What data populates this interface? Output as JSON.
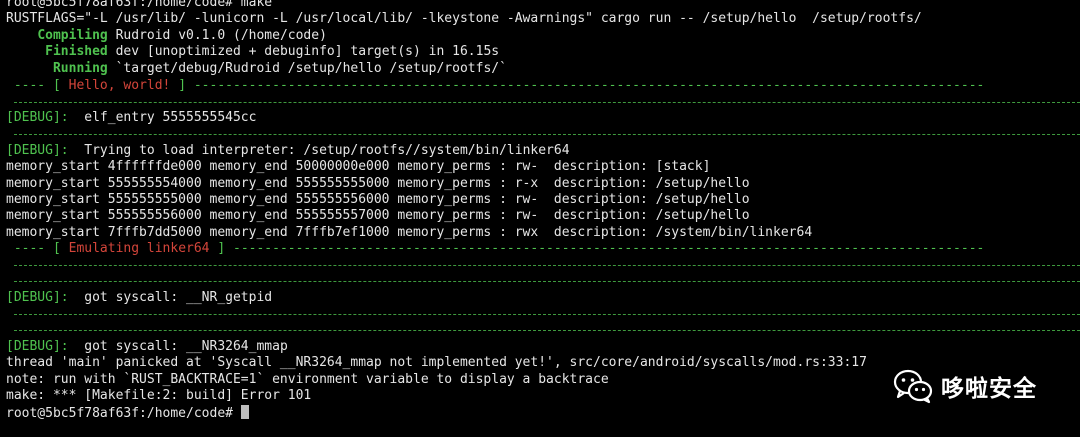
{
  "terminal": {
    "prompt_top": "root@5bc5f78af63f:/home/code# make",
    "cmd_rustflags": "RUSTFLAGS=\"-L /usr/lib/ -lunicorn -L /usr/local/lib/ -lkeystone -Awarnings\" cargo run -- /setup/hello  /setup/rootfs/",
    "compiling_label": "Compiling",
    "compiling_text": " Rudroid v0.1.0 (/home/code)",
    "finished_label": "Finished",
    "finished_text": " dev [unoptimized + debuginfo] target(s) in 16.15s",
    "running_label": "Running",
    "running_text": " `target/debug/Rudroid /setup/hello /setup/rootfs/`",
    "banner1_prefix": " ---- [ ",
    "banner1_text": "Hello, world!",
    "banner1_suffix": " ] -----------------------------------------------------------------------------------------------------",
    "debug_tag": "[DEBUG]:",
    "debug1_text": "  elf_entry 5555555545cc",
    "debug2_text": "  Trying to load interpreter: /setup/rootfs//system/bin/linker64",
    "mem_rows": [
      "memory_start 4ffffffde000 memory_end 50000000e000 memory_perms : rw-  description: [stack]",
      "memory_start 555555554000 memory_end 555555555000 memory_perms : r-x  description: /setup/hello",
      "memory_start 555555555000 memory_end 555555556000 memory_perms : rw-  description: /setup/hello",
      "memory_start 555555556000 memory_end 555555557000 memory_perms : rw-  description: /setup/hello",
      "memory_start 7fffb7dd5000 memory_end 7fffb7ef1000 memory_perms : rwx  description: /system/bin/linker64"
    ],
    "banner2_prefix": " ---- [ ",
    "banner2_text": "Emulating linker64",
    "banner2_suffix": " ] ------------------------------------------------------------------------------------------------",
    "debug3_text": "  got syscall: __NR_getpid",
    "debug4_text": "  got syscall: __NR3264_mmap",
    "panic_line": "thread 'main' panicked at 'Syscall __NR3264_mmap not implemented yet!', src/core/android/syscalls/mod.rs:33:17",
    "note_line": "note: run with `RUST_BACKTRACE=1` environment variable to display a backtrace",
    "make_error": "make: *** [Makefile:2: build] Error 101",
    "prompt_bottom": "root@5bc5f78af63f:/home/code# "
  },
  "watermark": {
    "text": "哆啦安全",
    "icon": "wechat-icon"
  },
  "colors": {
    "background": "#000000",
    "text": "#e6e6e6",
    "green": "#4fc24f",
    "red": "#d4453a"
  }
}
